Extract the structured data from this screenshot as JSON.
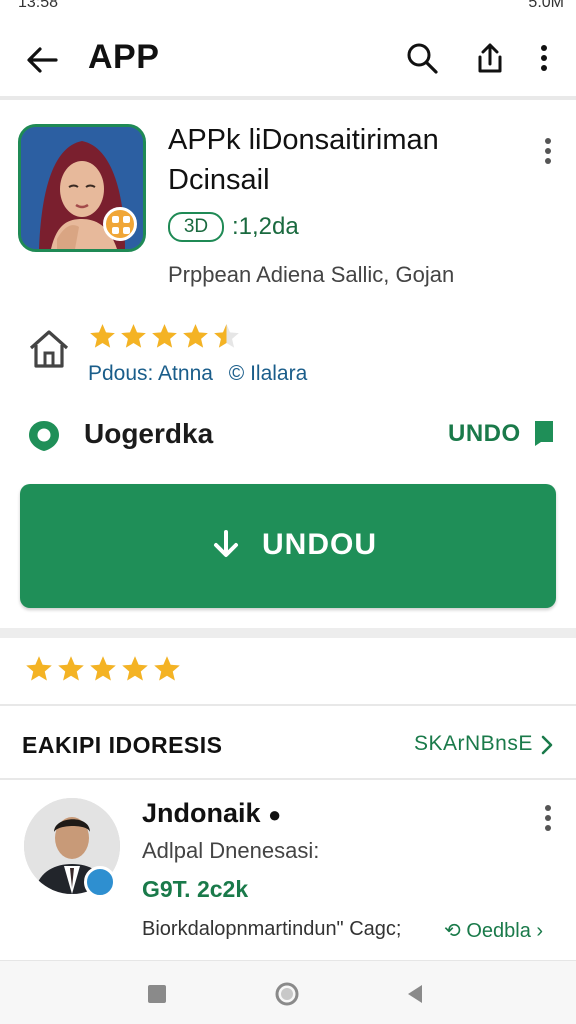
{
  "status_bar": {
    "time": "13:58",
    "right": "5.0M"
  },
  "app_bar": {
    "title": "APP"
  },
  "app": {
    "name_line1": "APPk liDonsaitiriman",
    "name_line2": "Dcinsail",
    "age_badge": "3D",
    "downloads": ":1,2da",
    "developer": "Prpþean Adiena  Sallic, Gojan"
  },
  "rating": {
    "stars": 4.5,
    "meta_left": "Pdous: Atnna",
    "meta_lang": "© Ilalara"
  },
  "location": {
    "label": "Uogerdka",
    "action": "UNDO"
  },
  "install_button": {
    "label": "UNDOU"
  },
  "rate_this": {
    "stars": 5
  },
  "reviews": {
    "section_title": "EAKIPI IDORESIS",
    "section_link": "SKArNBnsE",
    "item": {
      "name": "Jndonaik",
      "subtitle": "Adlpal Dnenesasi:",
      "count": "G9T. 2c2k",
      "text": "Biorkdalopnmartindun\" Cagc;",
      "action": "Oedbla"
    }
  },
  "colors": {
    "accent": "#1f8f58",
    "star": "#f4b324",
    "link": "#1a5d8a"
  },
  "icons": {
    "back": "arrow-left-icon",
    "search": "search-icon",
    "share": "share-icon",
    "more": "more-vert-icon",
    "house": "house-icon",
    "location": "location-icon",
    "flag": "flag-icon",
    "download": "download-icon",
    "chevron": "chevron-right-icon",
    "nav_recents": "square-icon",
    "nav_home": "circle-icon",
    "nav_back": "triangle-left-icon"
  }
}
